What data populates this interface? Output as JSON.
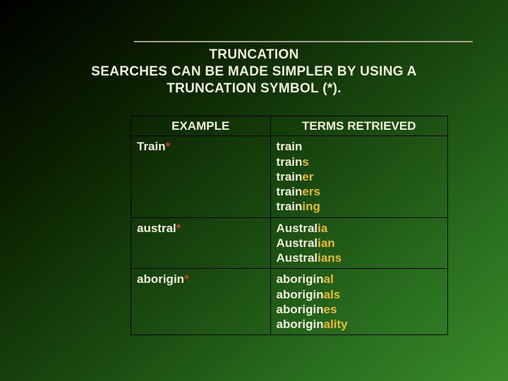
{
  "title": {
    "line1": "TRUNCATION",
    "line2": "SEARCHES CAN BE MADE SIMPLER BY USING A",
    "line3": "TRUNCATION SYMBOL (*)."
  },
  "headers": {
    "example": "EXAMPLE",
    "terms": "TERMS RETRIEVED"
  },
  "rows": [
    {
      "example_stem": "Train",
      "example_star": "*",
      "terms": [
        {
          "pre": "train",
          "hi": ""
        },
        {
          "pre": "train",
          "hi": "s"
        },
        {
          "pre": "train",
          "hi": "er"
        },
        {
          "pre": "train",
          "hi": "ers"
        },
        {
          "pre": "train",
          "hi": "ing"
        }
      ]
    },
    {
      "example_stem": "austral",
      "example_star": "*",
      "terms": [
        {
          "pre": "Austral",
          "hi": "ia"
        },
        {
          "pre": "Austral",
          "hi": "ian"
        },
        {
          "pre": "Austral",
          "hi": "ians"
        }
      ]
    },
    {
      "example_stem": "aborigin",
      "example_star": "*",
      "terms": [
        {
          "pre": "aborigin",
          "hi": "al"
        },
        {
          "pre": "aborigin",
          "hi": "als"
        },
        {
          "pre": "aborigin",
          "hi": "es"
        },
        {
          "pre": "aborigin",
          "hi": "ality"
        }
      ]
    }
  ]
}
